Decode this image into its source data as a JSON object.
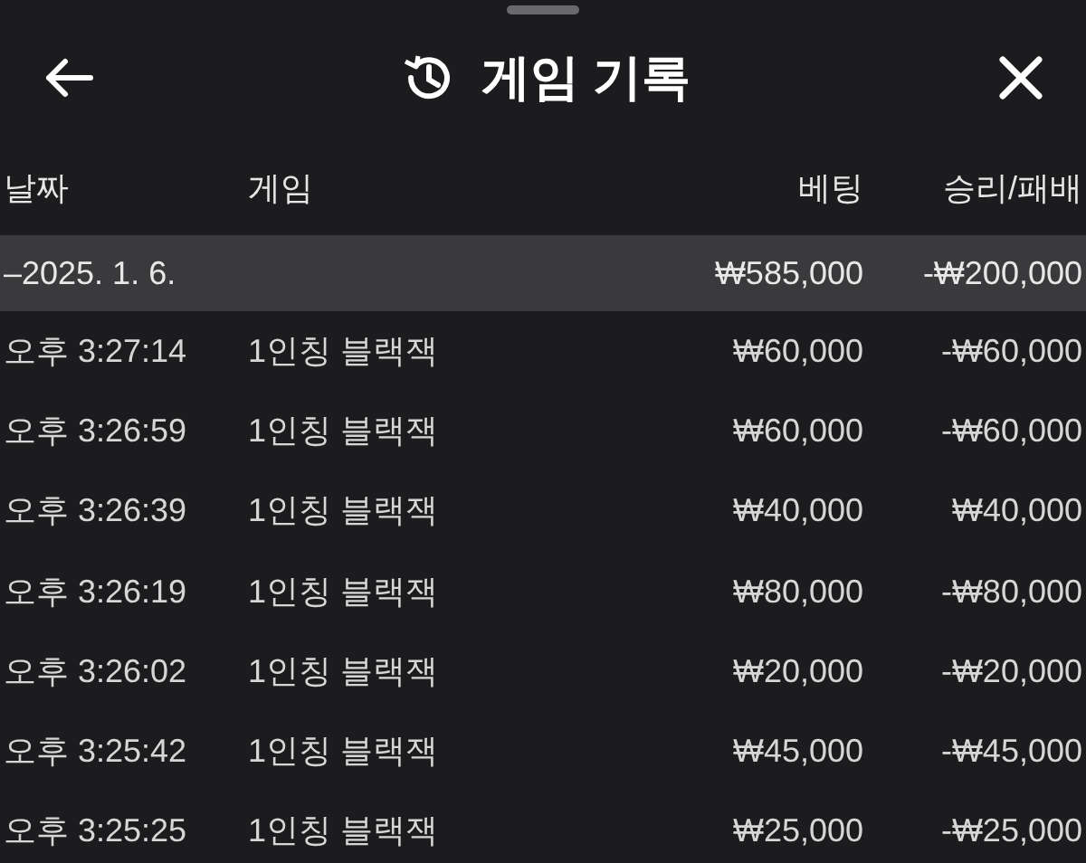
{
  "header": {
    "title": "게임 기록"
  },
  "columns": [
    "날짜",
    "게임",
    "베팅",
    "승리/패배"
  ],
  "group": {
    "date": "–2025. 1. 6.",
    "bet": "₩585,000",
    "result": "-₩200,000"
  },
  "rows": [
    {
      "time": "오후 3:27:14",
      "game": "1인칭 블랙잭",
      "bet": "₩60,000",
      "result": "-₩60,000"
    },
    {
      "time": "오후 3:26:59",
      "game": "1인칭 블랙잭",
      "bet": "₩60,000",
      "result": "-₩60,000"
    },
    {
      "time": "오후 3:26:39",
      "game": "1인칭 블랙잭",
      "bet": "₩40,000",
      "result": "₩40,000"
    },
    {
      "time": "오후 3:26:19",
      "game": "1인칭 블랙잭",
      "bet": "₩80,000",
      "result": "-₩80,000"
    },
    {
      "time": "오후 3:26:02",
      "game": "1인칭 블랙잭",
      "bet": "₩20,000",
      "result": "-₩20,000"
    },
    {
      "time": "오후 3:25:42",
      "game": "1인칭 블랙잭",
      "bet": "₩45,000",
      "result": "-₩45,000"
    },
    {
      "time": "오후 3:25:25",
      "game": "1인칭 블랙잭",
      "bet": "₩25,000",
      "result": "-₩25,000"
    }
  ]
}
